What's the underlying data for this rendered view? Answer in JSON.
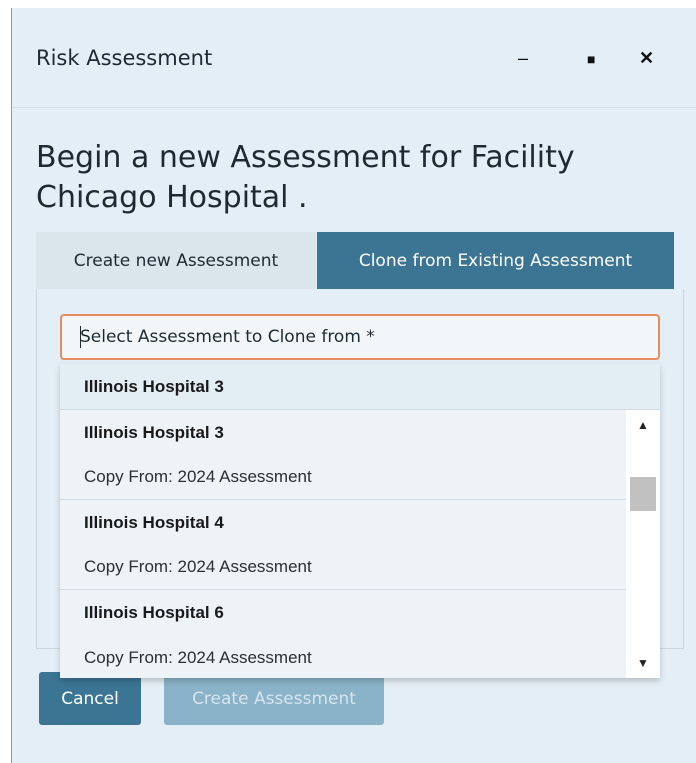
{
  "window": {
    "title": "Risk Assessment",
    "minimize_label": "–",
    "maximize_label": "■",
    "close_label": "✕"
  },
  "heading": "Begin a new Assessment for Facility Chicago Hospital .",
  "tabs": [
    {
      "label": "Create new Assessment",
      "active": false
    },
    {
      "label": "Clone from Existing Assessment",
      "active": true
    }
  ],
  "select": {
    "placeholder": "Select Assessment to Clone from *"
  },
  "dropdown": {
    "group_header": "Illinois Hospital 3",
    "items": [
      {
        "name": "Illinois Hospital 3",
        "option": "Copy From: 2024 Assessment"
      },
      {
        "name": "Illinois Hospital 4",
        "option": "Copy From: 2024 Assessment"
      },
      {
        "name": "Illinois Hospital 6",
        "option": "Copy From: 2024 Assessment"
      }
    ],
    "scroll_up_icon": "▲",
    "scroll_down_icon": "▼"
  },
  "buttons": {
    "cancel": "Cancel",
    "create": "Create Assessment"
  },
  "colors": {
    "accent": "#3b7593",
    "focus_border": "#e28c5f",
    "dialog_bg": "#e4eef6"
  }
}
